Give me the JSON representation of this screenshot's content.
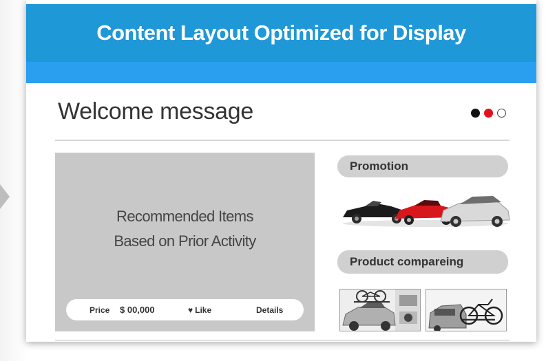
{
  "header": {
    "title": "Content Layout Optimized for Display"
  },
  "welcome": {
    "text": "Welcome message"
  },
  "carousel": {
    "indicators": [
      "black",
      "red",
      "empty"
    ],
    "active_index": 1,
    "colors": {
      "active": "#e3111b",
      "filled": "#111111"
    }
  },
  "recommended": {
    "line1": "Recommended Items",
    "line2": "Based on Prior Activity",
    "price_label": "Price",
    "price_value": "$ 00,000",
    "like_label": "Like",
    "details_label": "Details"
  },
  "sidebar": {
    "promotion_label": "Promotion",
    "promotion_image": "three-cars-image",
    "compare_label": "Product compareing",
    "compare_images": [
      "bike-rack-roof-image",
      "bike-rack-hitch-image"
    ]
  },
  "colors": {
    "header": "#1f98d8",
    "subheader": "#2a9ff0",
    "panel": "#c8c8c8",
    "pill": "#d0d0d0"
  }
}
